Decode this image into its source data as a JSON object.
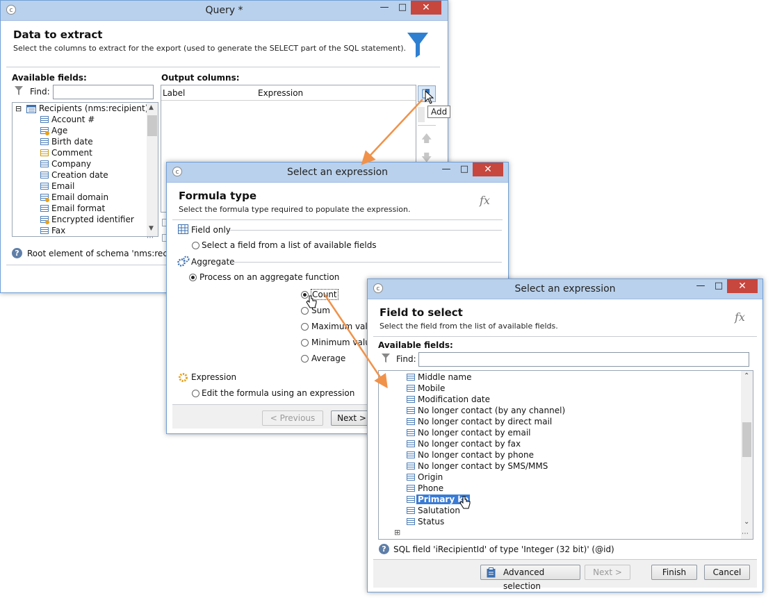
{
  "query_window": {
    "title": "Query *",
    "header_title": "Data to extract",
    "header_subtitle": "Select the columns to extract for the export (used to generate the SELECT part of the SQL statement).",
    "available_fields_label": "Available fields:",
    "find_label": "Find:",
    "output_columns_label": "Output columns:",
    "col_label": "Label",
    "col_expression": "Expression",
    "add_tooltip": "Add",
    "tree_root": "Recipients (nms:recipient)",
    "tree_items": [
      {
        "label": "Account #",
        "icon": "field-icon"
      },
      {
        "label": "Age",
        "icon": "computed-field-icon"
      },
      {
        "label": "Birth date",
        "icon": "field-icon"
      },
      {
        "label": "Comment",
        "icon": "memo-field-icon"
      },
      {
        "label": "Company",
        "icon": "field-icon"
      },
      {
        "label": "Creation date",
        "icon": "field-icon"
      },
      {
        "label": "Email",
        "icon": "field-icon"
      },
      {
        "label": "Email domain",
        "icon": "computed-field-icon"
      },
      {
        "label": "Email format",
        "icon": "field-icon"
      },
      {
        "label": "Encrypted identifier",
        "icon": "computed-field-icon"
      },
      {
        "label": "Fax",
        "icon": "field-icon"
      }
    ],
    "status_text": "Root element of schema 'nms:recipien"
  },
  "formula_window": {
    "title": "Select an expression",
    "header_title": "Formula type",
    "header_subtitle": "Select the formula type required to populate the expression.",
    "fx": "fx",
    "field_only_label": "Field only",
    "field_only_option": "Select a field from a list of available fields",
    "aggregate_label": "Aggregate",
    "aggregate_option": "Process on an aggregate function",
    "functions": [
      "Count",
      "Sum",
      "Maximum valu",
      "Minimum valu",
      "Average"
    ],
    "selected_function": "Count",
    "expression_label": "Expression",
    "expression_option": "Edit the formula using an expression",
    "previous_button": "< Previous",
    "next_button": "Next >"
  },
  "field_window": {
    "title": "Select an expression",
    "header_title": "Field to select",
    "header_subtitle": "Select the field from the list of available fields.",
    "fx": "fx",
    "available_fields_label": "Available fields:",
    "find_label": "Find:",
    "items": [
      "Middle name",
      "Mobile",
      "Modification date",
      "No longer contact (by any channel)",
      "No longer contact by direct mail",
      "No longer contact by email",
      "No longer contact by fax",
      "No longer contact by phone",
      "No longer contact by SMS/MMS",
      "Origin",
      "Phone",
      "Primary ke",
      "Salutation",
      "Status"
    ],
    "selected_item": "Primary ke",
    "status_text": "SQL field 'iRecipientId' of type 'Integer (32 bit)' (@id)",
    "advanced_button": "Advanced selection",
    "next_button": "Next >",
    "finish_button": "Finish",
    "cancel_button": "Cancel"
  },
  "colors": {
    "title_bar": "#b9d1ec",
    "close_button": "#c7463e",
    "selection": "#3a7bd5",
    "arrow": "#f0924a",
    "funnel": "#2f7fd1"
  }
}
